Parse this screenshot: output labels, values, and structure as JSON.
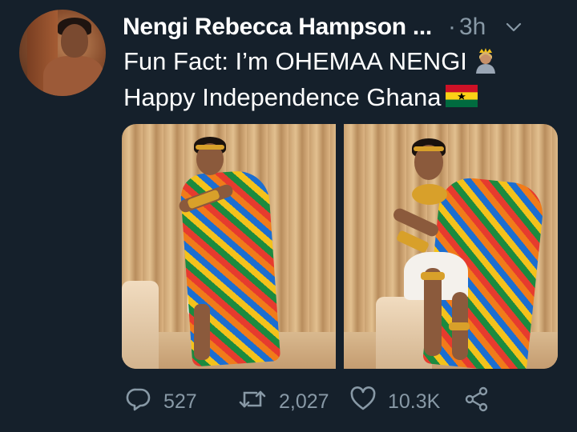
{
  "author": {
    "name": "Nengi Rebecca Hampson ...",
    "separator": "·",
    "time": "3h"
  },
  "tweet": {
    "line1": "Fun Fact: I’m OHEMAA NENGI",
    "line2": "Happy Independence Ghana",
    "emoji1": "princess-emoji",
    "emoji2": "ghana-flag-emoji"
  },
  "media": {
    "count": 2
  },
  "actions": {
    "replies": "527",
    "retweets": "2,027",
    "likes": "10.3K"
  },
  "colors": {
    "background": "#15202b",
    "text": "#ffffff",
    "secondary": "#8899a6"
  },
  "icons": {
    "reply": "reply-icon",
    "retweet": "retweet-icon",
    "like": "heart-icon",
    "share": "share-icon",
    "menu": "chevron-down-icon"
  }
}
